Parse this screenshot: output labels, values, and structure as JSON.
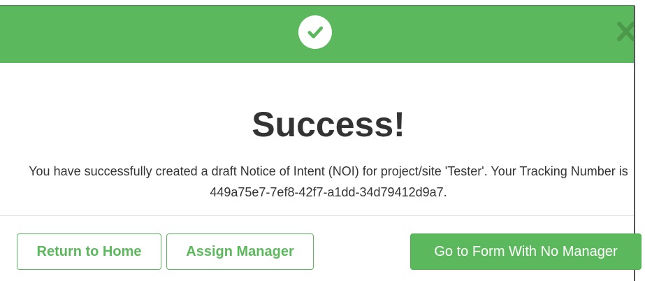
{
  "modal": {
    "header": {
      "icon": "check-circle-icon",
      "close_icon": "close-icon",
      "color": "#5cb85c"
    },
    "title": "Success!",
    "message": "You have successfully created a draft Notice of Intent (NOI) for project/site 'Tester'. Your Tracking Number is 449a75e7-7ef8-42f7-a1dd-34d79412d9a7.",
    "buttons": {
      "return_home": "Return to Home",
      "assign_manager": "Assign Manager",
      "go_to_form": "Go to Form With No Manager"
    }
  }
}
